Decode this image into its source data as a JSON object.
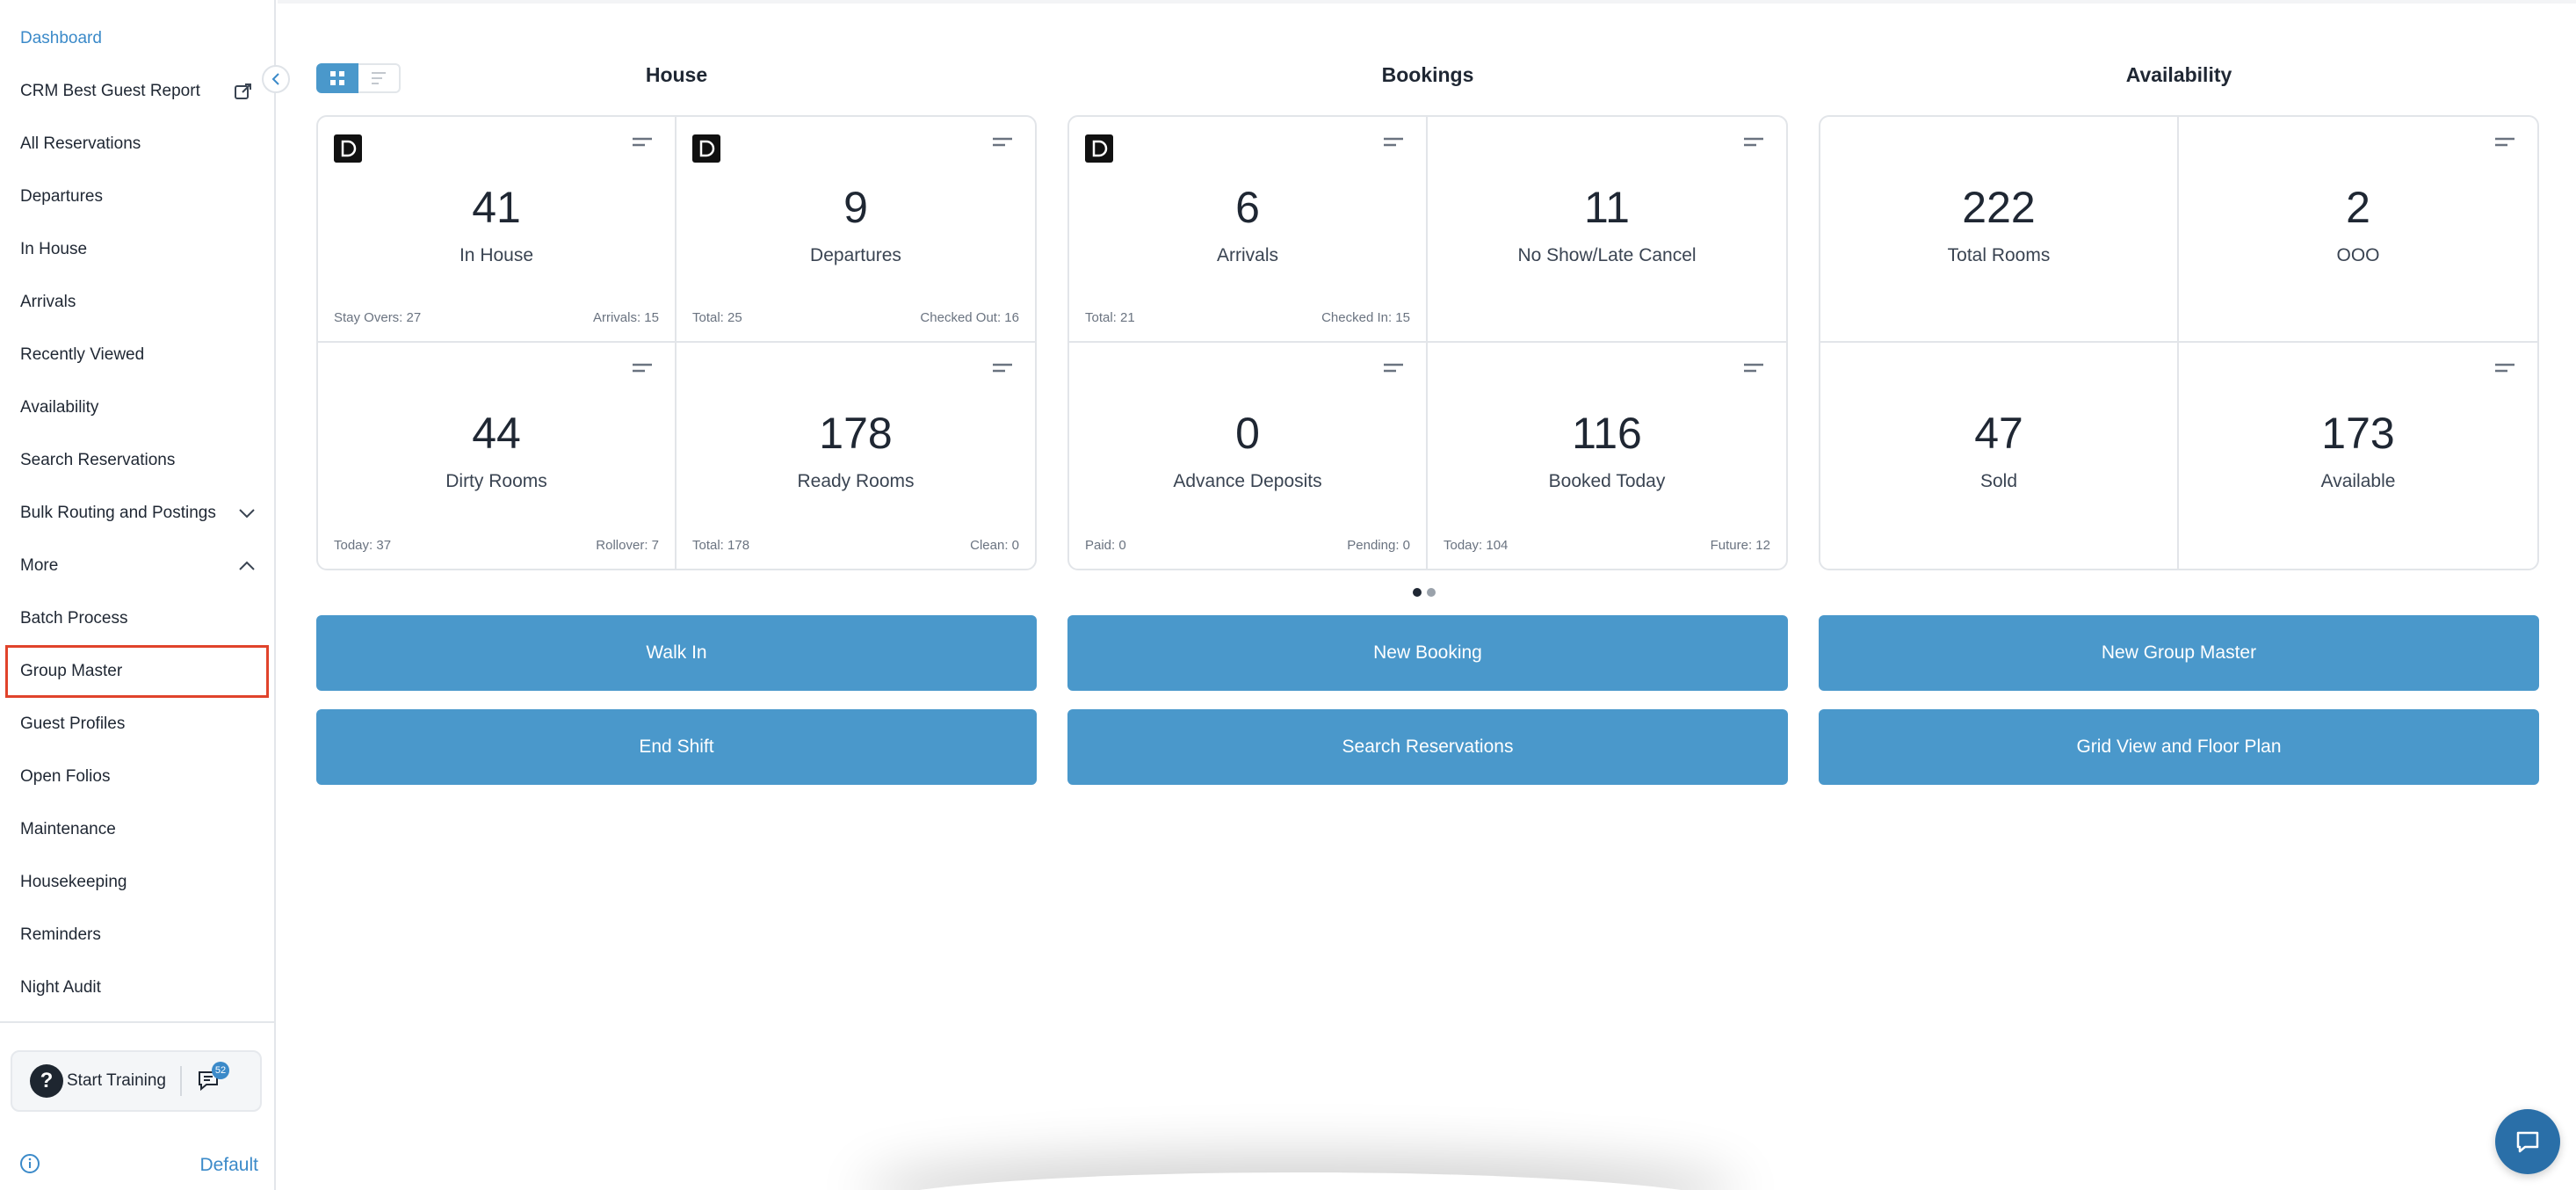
{
  "sidebar": {
    "items": [
      {
        "label": "Dashboard"
      },
      {
        "label": "CRM Best Guest Report"
      },
      {
        "label": "All Reservations"
      },
      {
        "label": "Departures"
      },
      {
        "label": "In House"
      },
      {
        "label": "Arrivals"
      },
      {
        "label": "Recently Viewed"
      },
      {
        "label": "Availability"
      },
      {
        "label": "Search Reservations"
      },
      {
        "label": "Bulk Routing and Postings"
      },
      {
        "label": "More"
      },
      {
        "label": "Batch Process"
      },
      {
        "label": "Group Master"
      },
      {
        "label": "Guest Profiles"
      },
      {
        "label": "Open Folios"
      },
      {
        "label": "Maintenance"
      },
      {
        "label": "Housekeeping"
      },
      {
        "label": "Reminders"
      },
      {
        "label": "Night Audit"
      }
    ],
    "training_label": "Start Training",
    "help_glyph": "?",
    "chat_badge": "52",
    "footer_link": "Default"
  },
  "columns": [
    {
      "title": "House"
    },
    {
      "title": "Bookings"
    },
    {
      "title": "Availability"
    }
  ],
  "panels": [
    {
      "cards": [
        {
          "value": "41",
          "label": "In House",
          "foot_left": "Stay Overs: 27",
          "foot_right": "Arrivals: 15",
          "logo": "D"
        },
        {
          "value": "9",
          "label": "Departures",
          "foot_left": "Total: 25",
          "foot_right": "Checked Out: 16",
          "logo": "D"
        },
        {
          "value": "44",
          "label": "Dirty Rooms",
          "foot_left": "Today: 37",
          "foot_right": "Rollover: 7"
        },
        {
          "value": "178",
          "label": "Ready Rooms",
          "foot_left": "Total: 178",
          "foot_right": "Clean: 0"
        }
      ]
    },
    {
      "cards": [
        {
          "value": "6",
          "label": "Arrivals",
          "foot_left": "Total: 21",
          "foot_right": "Checked In: 15",
          "logo": "D"
        },
        {
          "value": "11",
          "label": "No Show/Late Cancel",
          "foot_left": "",
          "foot_right": ""
        },
        {
          "value": "0",
          "label": "Advance Deposits",
          "foot_left": "Paid: 0",
          "foot_right": "Pending: 0"
        },
        {
          "value": "116",
          "label": "Booked Today",
          "foot_left": "Today: 104",
          "foot_right": "Future: 12"
        }
      ]
    },
    {
      "cards": [
        {
          "value": "222",
          "label": "Total Rooms",
          "foot_left": "",
          "foot_right": ""
        },
        {
          "value": "2",
          "label": "OOO",
          "foot_left": "",
          "foot_right": ""
        },
        {
          "value": "47",
          "label": "Sold",
          "foot_left": "",
          "foot_right": ""
        },
        {
          "value": "173",
          "label": "Available",
          "foot_left": "",
          "foot_right": ""
        }
      ]
    }
  ],
  "carousel": {
    "pages": 2,
    "active": 1
  },
  "actions": {
    "walk_in": "Walk In",
    "new_booking": "New Booking",
    "new_group_master": "New Group Master",
    "end_shift": "End Shift",
    "search_reservations": "Search Reservations",
    "grid_view": "Grid View and Floor Plan"
  },
  "colors": {
    "accent": "#4a98cb",
    "active_link": "#3b8ac9",
    "highlight_outline": "#e0432b",
    "chat_button": "#2a6fa8"
  }
}
